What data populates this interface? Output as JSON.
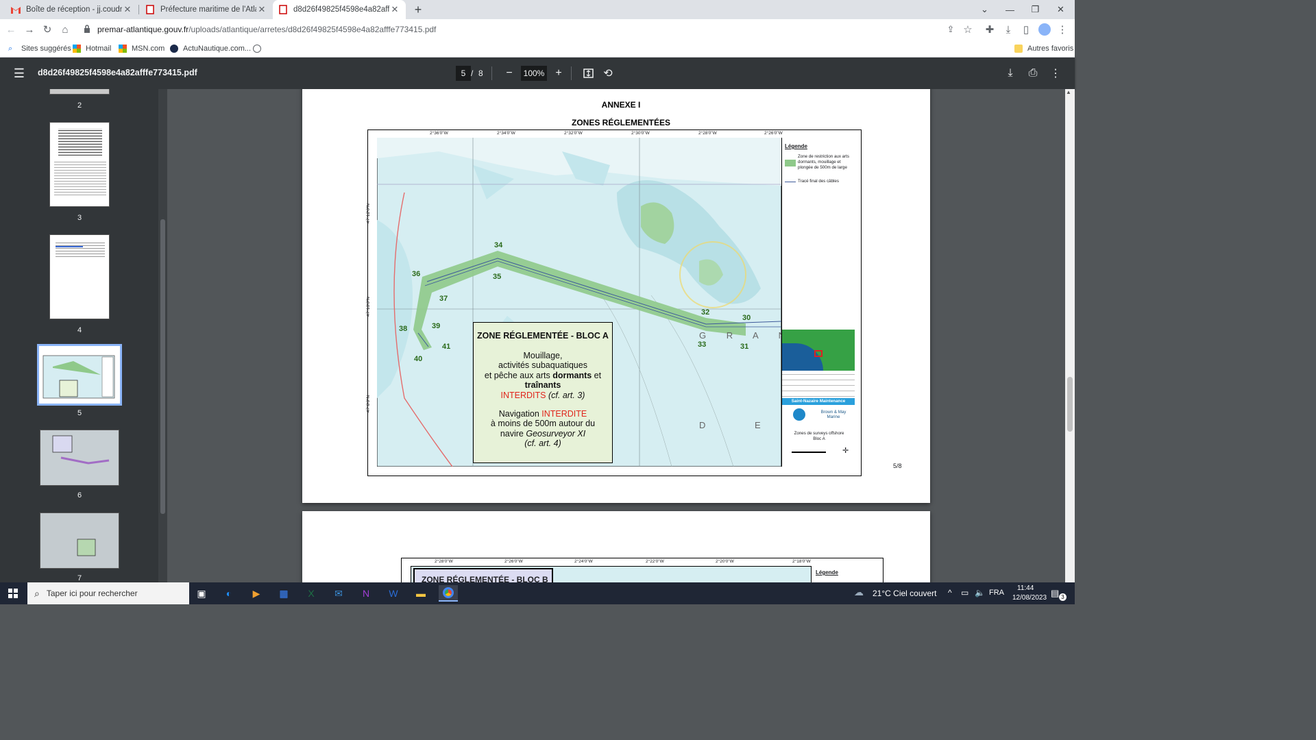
{
  "tabs": [
    {
      "title": "Boîte de réception - jj.coudray@",
      "icon": "gmail-icon",
      "active": false
    },
    {
      "title": "Préfecture maritime de l'Atlantiq",
      "icon": "prefecture-icon",
      "active": false
    },
    {
      "title": "d8d26f49825f4598e4a82afffe773",
      "icon": "pdf-icon",
      "active": true
    }
  ],
  "address": {
    "domain": "premar-atlantique.gouv.fr",
    "path": "/uploads/atlantique/arretes/d8d26f49825f4598e4a82afffe773415.pdf"
  },
  "bookmarks": [
    "Sites suggérés",
    "Hotmail",
    "MSN.com",
    "ActuNautique.com..."
  ],
  "bookmarks_other": "Autres favoris",
  "pdf": {
    "filename": "d8d26f49825f4598e4a82afffe773415.pdf",
    "current_page": "5",
    "page_separator": "/",
    "total_pages": "8",
    "zoom": "100%"
  },
  "thumbnails": [
    "2",
    "3",
    "4",
    "5",
    "6",
    "7"
  ],
  "page5": {
    "annex": "ANNEXE I",
    "title": "ZONES RÉGLEMENTÉES",
    "page_number": "5/8",
    "top_coords": [
      "2°36'0\"W",
      "2°34'0\"W",
      "2°32'0\"W",
      "2°30'0\"W",
      "2°28'0\"W",
      "2°26'0\"W"
    ],
    "side_coords": [
      "47°12'0\"N",
      "47°10'0\"N",
      "47°8'0\"N"
    ],
    "points": [
      "34",
      "35",
      "36",
      "37",
      "38",
      "39",
      "40",
      "41",
      "32",
      "30",
      "33",
      "31"
    ],
    "box": {
      "heading": "ZONE RÉGLEMENTÉE - BLOC A",
      "l1": "Mouillage,",
      "l2": "activités subaquatiques",
      "l3a": "et pêche aux arts ",
      "l3b": "dormants",
      "l3c": " et",
      "l4": "traînants",
      "l5a": "INTERDITS",
      "l5b": " (cf. art. 3)",
      "l6a": "Navigation ",
      "l6b": "INTERDITE",
      "l7": "à moins de 500m autour du",
      "l8a": "navire ",
      "l8b": "Geosurveyor XI",
      "l9": "(cf. art. 4)"
    },
    "map_letters": [
      "G R A N",
      "D E L"
    ],
    "legend": {
      "title": "Légende",
      "item1": "Zone de restriction aux arts dormants, mouillage et plongée de 500m de large",
      "item2": "Tracé final des câbles",
      "company": "Saint-Nazaire Maintenance",
      "partner": "Brown & May Marine",
      "caption1": "Zones de surveys offshore",
      "caption2": "Bloc A"
    }
  },
  "page6": {
    "top_coords": [
      "2°28'0\"W",
      "2°26'0\"W",
      "2°24'0\"W",
      "2°22'0\"W",
      "2°20'0\"W",
      "2°18'0\"W"
    ],
    "box_heading": "ZONE RÉGLEMENTÉE - BLOC B",
    "legend_title": "Légende"
  },
  "taskbar": {
    "search_placeholder": "Taper ici pour rechercher",
    "weather": "21°C  Ciel couvert",
    "lang": "FRA",
    "time": "11:44",
    "date": "12/08/2023",
    "notif_count": "3"
  },
  "colors": {
    "zone_green": "#8fc98a",
    "accent_blue": "#8ab4f8",
    "red": "#e0251b",
    "pdf_toolbar": "#323639"
  }
}
